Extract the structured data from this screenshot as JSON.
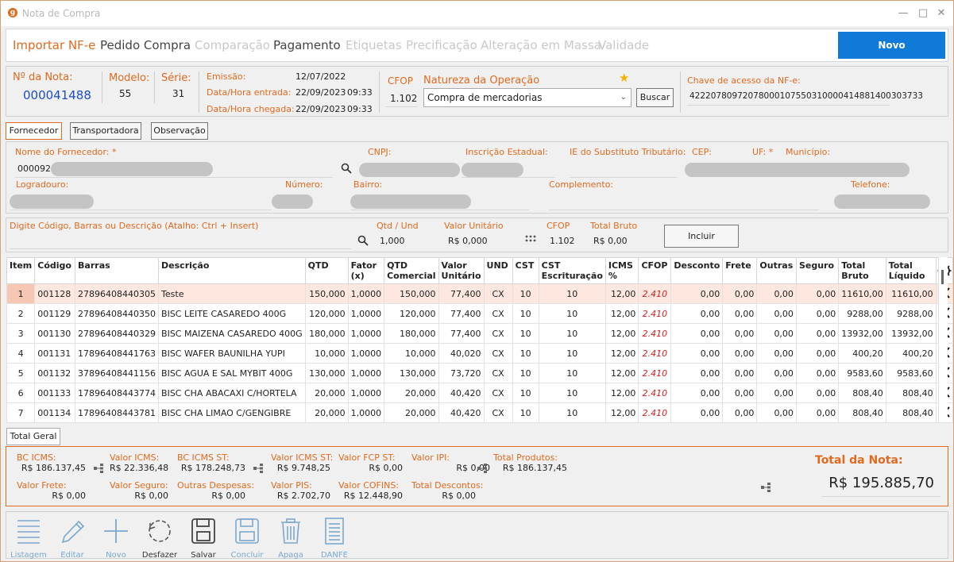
{
  "window": {
    "title": "Nota de Compra",
    "app_icon_letter": "g"
  },
  "nav": {
    "tabs": [
      "Importar NF-e",
      "Pedido Compra",
      "Comparação",
      "Pagamento",
      "Etiquetas",
      "Precificação",
      "Alteração em Massa",
      "Validade"
    ],
    "novo_label": "Novo"
  },
  "header": {
    "nota_label": "Nº da Nota:",
    "nota_value": "000041488",
    "modelo_label": "Modelo:",
    "modelo_value": "55",
    "serie_label": "Série:",
    "serie_value": "31",
    "emissao_label": "Emissão:",
    "emissao_value": "12/07/2022",
    "entrada_label": "Data/Hora entrada:",
    "entrada_date": "22/09/2023",
    "entrada_time": "09:33",
    "chegada_label": "Data/Hora chegada:",
    "chegada_date": "22/09/2023",
    "chegada_time": "09:33",
    "cfop_label": "CFOP",
    "cfop_value": "1.102",
    "natureza_label": "Natureza da Operação",
    "natureza_value": "Compra de mercadorias",
    "buscar_label": "Buscar",
    "chave_label": "Chave de acesso da NF-e:",
    "chave_value": "42220780972078000107550310000414881400303733"
  },
  "subtabs": [
    "Fornecedor",
    "Transportadora",
    "Observação"
  ],
  "fornecedor": {
    "nome_label": "Nome do Fornecedor: *",
    "codigo": "000092",
    "cnpj_label": "CNPJ:",
    "ie_label": "Inscrição Estadual:",
    "iest_label": "IE do Substituto Tributário:",
    "cep_label": "CEP:",
    "uf_label": "UF: *",
    "municipio_label": "Município:",
    "logradouro_label": "Logradouro:",
    "numero_label": "Número:",
    "bairro_label": "Bairro:",
    "complemento_label": "Complemento:",
    "telefone_label": "Telefone:"
  },
  "entry": {
    "search_label": "Digite Código, Barras ou Descrição (Atalho: Ctrl + Insert)",
    "qtd_label": "Qtd / Und",
    "qtd_value": "1,000",
    "valor_label": "Valor Unitário",
    "valor_value": "R$ 0,000",
    "cfop_label": "CFOP",
    "cfop_value": "1.102",
    "total_label": "Total Bruto",
    "total_value": "R$ 0,00",
    "incluir_label": "Incluir"
  },
  "table": {
    "columns": [
      [
        "Item",
        ""
      ],
      [
        "Código",
        ""
      ],
      [
        "Barras",
        ""
      ],
      [
        "Descrição",
        ""
      ],
      [
        "QTD",
        ""
      ],
      [
        "Fator",
        "(x)"
      ],
      [
        "QTD",
        "Comercial"
      ],
      [
        "Valor",
        "Unitário"
      ],
      [
        "UND",
        ""
      ],
      [
        "CST",
        ""
      ],
      [
        "CST",
        "Escrituração"
      ],
      [
        "ICMS %",
        ""
      ],
      [
        "CFOP",
        ""
      ],
      [
        "Desconto",
        ""
      ],
      [
        "Frete",
        ""
      ],
      [
        "Outras",
        ""
      ],
      [
        "Seguro",
        ""
      ],
      [
        "Total",
        "Bruto"
      ],
      [
        "Total",
        "Líquido"
      ]
    ],
    "rows": [
      [
        "1",
        "001128",
        "27896408440305",
        "Teste",
        "150,000",
        "1,0000",
        "150,000",
        "77,400",
        "CX",
        "10",
        "10",
        "12,00",
        "2.410",
        "0,00",
        "0,00",
        "0,00",
        "0,00",
        "11610,00",
        "11610,00"
      ],
      [
        "2",
        "001129",
        "27896408440350",
        "BISC LEITE CASAREDO 400G",
        "120,000",
        "1,0000",
        "120,000",
        "77,400",
        "CX",
        "10",
        "10",
        "12,00",
        "2.410",
        "0,00",
        "0,00",
        "0,00",
        "0,00",
        "9288,00",
        "9288,00"
      ],
      [
        "3",
        "001130",
        "27896408440329",
        "BISC MAIZENA CASAREDO 400G",
        "180,000",
        "1,0000",
        "180,000",
        "77,400",
        "CX",
        "10",
        "10",
        "12,00",
        "2.410",
        "0,00",
        "0,00",
        "0,00",
        "0,00",
        "13932,00",
        "13932,00"
      ],
      [
        "4",
        "001131",
        "17896408441763",
        "BISC WAFER BAUNILHA YUPI",
        "10,000",
        "1,0000",
        "10,000",
        "40,020",
        "CX",
        "10",
        "10",
        "12,00",
        "2.410",
        "0,00",
        "0,00",
        "0,00",
        "0,00",
        "400,20",
        "400,20"
      ],
      [
        "5",
        "001132",
        "37896408441156",
        "BISC AGUA E SAL MYBIT 400G",
        "130,000",
        "1,0000",
        "130,000",
        "73,720",
        "CX",
        "10",
        "10",
        "12,00",
        "2.410",
        "0,00",
        "0,00",
        "0,00",
        "0,00",
        "9583,60",
        "9583,60"
      ],
      [
        "6",
        "001133",
        "17896408443774",
        "BISC CHA ABACAXI C/HORTELA",
        "20,000",
        "1,0000",
        "20,000",
        "40,420",
        "CX",
        "10",
        "10",
        "12,00",
        "2.410",
        "0,00",
        "0,00",
        "0,00",
        "0,00",
        "808,40",
        "808,40"
      ],
      [
        "7",
        "001134",
        "17896408443781",
        "BISC CHA LIMAO C/GENGIBRE",
        "20,000",
        "1,0000",
        "20,000",
        "40,420",
        "CX",
        "10",
        "10",
        "12,00",
        "2.410",
        "0,00",
        "0,00",
        "0,00",
        "0,00",
        "808,40",
        "808,40"
      ]
    ]
  },
  "totals": {
    "tab_label": "Total Geral",
    "bc_icms_label": "BC ICMS:",
    "bc_icms": "R$ 186.137,45",
    "valor_icms_label": "Valor ICMS:",
    "valor_icms": "R$ 22.336,48",
    "bc_icms_st_label": "BC ICMS ST:",
    "bc_icms_st": "R$ 178.248,73",
    "valor_icms_st_label": "Valor ICMS ST:",
    "valor_icms_st": "R$ 9.748,25",
    "valor_fcp_st_label": "Valor FCP ST:",
    "valor_fcp_st": "R$ 0,00",
    "valor_ipi_label": "Valor IPI:",
    "valor_ipi": "R$ 0,00",
    "total_produtos_label": "Total Produtos:",
    "total_produtos": "R$ 186.137,45",
    "valor_frete_label": "Valor Frete:",
    "valor_frete": "R$ 0,00",
    "valor_seguro_label": "Valor Seguro:",
    "valor_seguro": "R$ 0,00",
    "outras_label": "Outras Despesas:",
    "outras": "R$ 0,00",
    "valor_pis_label": "Valor PIS:",
    "valor_pis": "R$ 2.702,70",
    "valor_cofins_label": "Valor COFINS:",
    "valor_cofins": "R$ 12.448,90",
    "total_descontos_label": "Total Descontos:",
    "total_descontos": "R$ 0,00",
    "total_nota_label": "Total da Nota:",
    "total_nota": "R$ 195.885,70"
  },
  "toolbar": {
    "listagem": "Listagem",
    "editar": "Editar",
    "novo": "Novo",
    "desfazer": "Desfazer",
    "salvar": "Salvar",
    "concluir": "Concluir",
    "apaga": "Apaga",
    "danfe": "DANFE"
  },
  "colors": {
    "accent": "#e06a1e",
    "primary": "#0f7ad8",
    "link": "#1a4fc2",
    "selected_row": "#fde7de",
    "cfop_red": "#d32020"
  }
}
